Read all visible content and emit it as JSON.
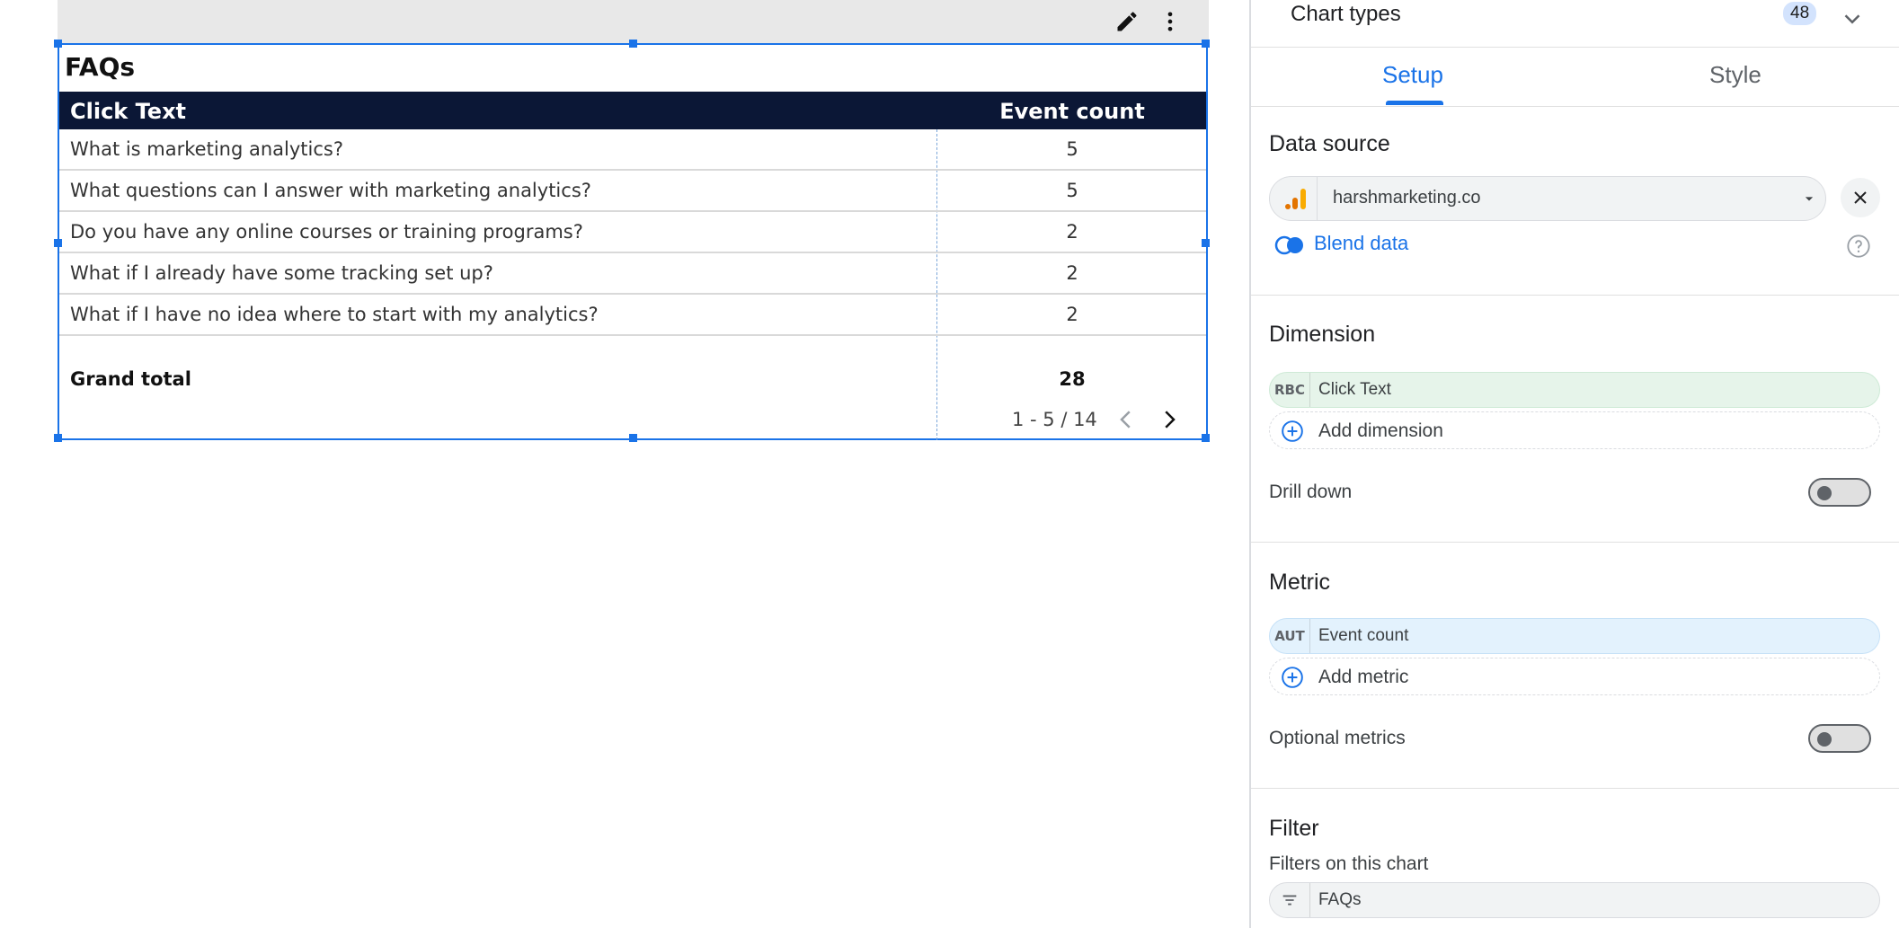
{
  "table_widget": {
    "title": "FAQs",
    "columns": [
      "Click Text",
      "Event count"
    ],
    "rows": [
      {
        "text": "What is marketing analytics?",
        "count": "5"
      },
      {
        "text": "What questions can I answer with marketing analytics?",
        "count": "5"
      },
      {
        "text": "Do you have any online courses or training programs?",
        "count": "2"
      },
      {
        "text": "What if I already have some tracking set up?",
        "count": "2"
      },
      {
        "text": "What if I have no idea where to start with my analytics?",
        "count": "2"
      }
    ],
    "grand_total_label": "Grand total",
    "grand_total_value": "28",
    "pagination": "1 - 5 / 14",
    "header_icons": [
      "pencil-icon",
      "more-vert-icon"
    ]
  },
  "panel": {
    "chart_types_label": "Chart types",
    "chart_types_count": "48",
    "tabs": [
      "Setup",
      "Style"
    ],
    "active_tab": "Setup",
    "data_source": {
      "title": "Data source",
      "name": "harshmarketing.co",
      "blend_label": "Blend data"
    },
    "dimension": {
      "title": "Dimension",
      "chip_tag": "RBC",
      "chip_label": "Click Text",
      "add_label": "Add dimension",
      "drill_down_label": "Drill down",
      "drill_down_on": false
    },
    "metric": {
      "title": "Metric",
      "chip_tag": "AUT",
      "chip_label": "Event count",
      "add_label": "Add metric",
      "optional_label": "Optional metrics",
      "optional_on": false
    },
    "filter": {
      "title": "Filter",
      "subtitle": "Filters on this chart",
      "chip_label": "FAQs"
    }
  },
  "colors": {
    "accent": "#1a73e8",
    "table_header_bg": "#0b1736",
    "dimension_chip": "#e6f4ea",
    "metric_chip": "#e3f2fd"
  }
}
